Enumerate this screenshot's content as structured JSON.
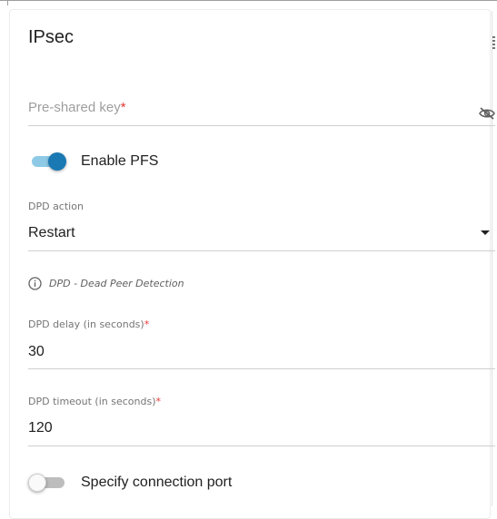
{
  "section": {
    "title": "IPsec"
  },
  "psk": {
    "placeholder": "Pre-shared key",
    "required_mark": "*"
  },
  "pfs": {
    "label": "Enable PFS",
    "enabled": true
  },
  "dpd_action": {
    "label": "DPD action",
    "value": "Restart"
  },
  "hint": {
    "text": "DPD - Dead Peer Detection"
  },
  "dpd_delay": {
    "label": "DPD delay (in seconds)",
    "required_mark": "*",
    "value": "30"
  },
  "dpd_timeout": {
    "label": "DPD timeout (in seconds)",
    "required_mark": "*",
    "value": "120"
  },
  "port": {
    "label": "Specify connection port",
    "enabled": false
  },
  "icons": {
    "password_visibility": "eye-off-icon",
    "info": "info-icon",
    "dropdown": "caret-down-icon"
  },
  "colors": {
    "accent": "#1a78b3",
    "accent_track": "#8ecae6",
    "required": "#e53935",
    "divider": "#cfcfcf"
  }
}
